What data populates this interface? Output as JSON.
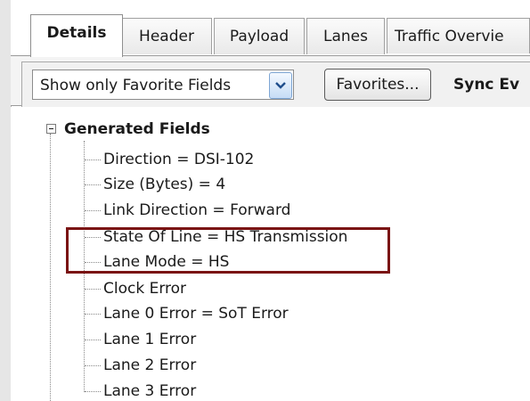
{
  "tabs": [
    {
      "label": "Details",
      "active": true
    },
    {
      "label": "Header",
      "active": false
    },
    {
      "label": "Payload",
      "active": false
    },
    {
      "label": "Lanes",
      "active": false
    },
    {
      "label": "Traffic Overvie",
      "active": false
    }
  ],
  "toolbar": {
    "filter_value": "Show only Favorite Fields",
    "favorites_label": "Favorites...",
    "sync_label": "Sync Ev"
  },
  "tree": {
    "group_label": "Generated Fields",
    "group_expanded": true,
    "items": [
      {
        "label": "Direction = DSI-102",
        "highlighted": false
      },
      {
        "label": "Size (Bytes) = 4",
        "highlighted": false
      },
      {
        "label": "Link Direction = Forward",
        "highlighted": false
      },
      {
        "label": "State Of Line = HS Transmission",
        "highlighted": true
      },
      {
        "label": "Lane Mode = HS",
        "highlighted": true
      },
      {
        "label": "Clock Error",
        "highlighted": false
      },
      {
        "label": "Lane 0 Error = SoT Error",
        "highlighted": false
      },
      {
        "label": "Lane 1 Error",
        "highlighted": false
      },
      {
        "label": "Lane 2 Error",
        "highlighted": false
      },
      {
        "label": "Lane 3 Error",
        "highlighted": false
      }
    ]
  },
  "colors": {
    "highlight_border": "#7a1414",
    "combo_button": "#c6dcf5"
  },
  "icons": {
    "combo_arrow": "chevron-down-icon",
    "expander": "minus-box-icon"
  }
}
